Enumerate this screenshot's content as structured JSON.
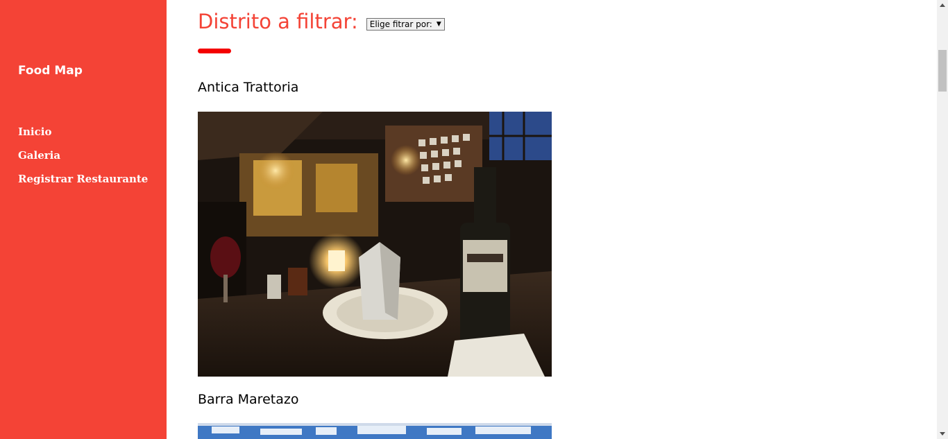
{
  "sidebar": {
    "brand": "Food Map",
    "items": [
      {
        "label": "Inicio"
      },
      {
        "label": "Galeria"
      },
      {
        "label": "Registrar Restaurante"
      }
    ],
    "background": "#f44336"
  },
  "filter": {
    "title": "Distrito a filtrar:",
    "select_value": "Elige fitrar por:",
    "accent": "#f44336"
  },
  "restaurants": [
    {
      "name": "Antica Trattoria",
      "photo": "restaurant-interior-photo"
    },
    {
      "name": "Barra Maretazo",
      "photo": "restaurant-exterior-photo"
    }
  ]
}
